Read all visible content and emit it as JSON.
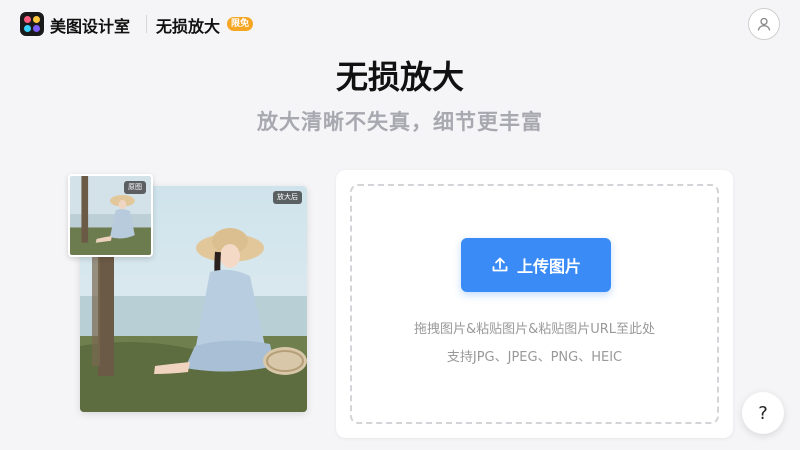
{
  "header": {
    "brand": "美图设计室",
    "tool_title": "无损放大",
    "badge": "限免",
    "logo_icon": "meitu-logo-icon",
    "avatar_icon": "user-icon"
  },
  "hero": {
    "title": "无损放大",
    "subtitle": "放大清晰不失真，细节更丰富"
  },
  "preview": {
    "before_tag": "原图",
    "after_tag": "放大后"
  },
  "upload": {
    "button_label": "上传图片",
    "button_icon": "upload-icon",
    "hint_line1": "拖拽图片&粘贴图片&粘贴图片URL至此处",
    "hint_line2": "支持JPG、JPEG、PNG、HEIC"
  },
  "help": {
    "label": "?"
  },
  "colors": {
    "accent": "#3a8bf6",
    "badge": "#f5a623",
    "background": "#f5f5f7"
  }
}
